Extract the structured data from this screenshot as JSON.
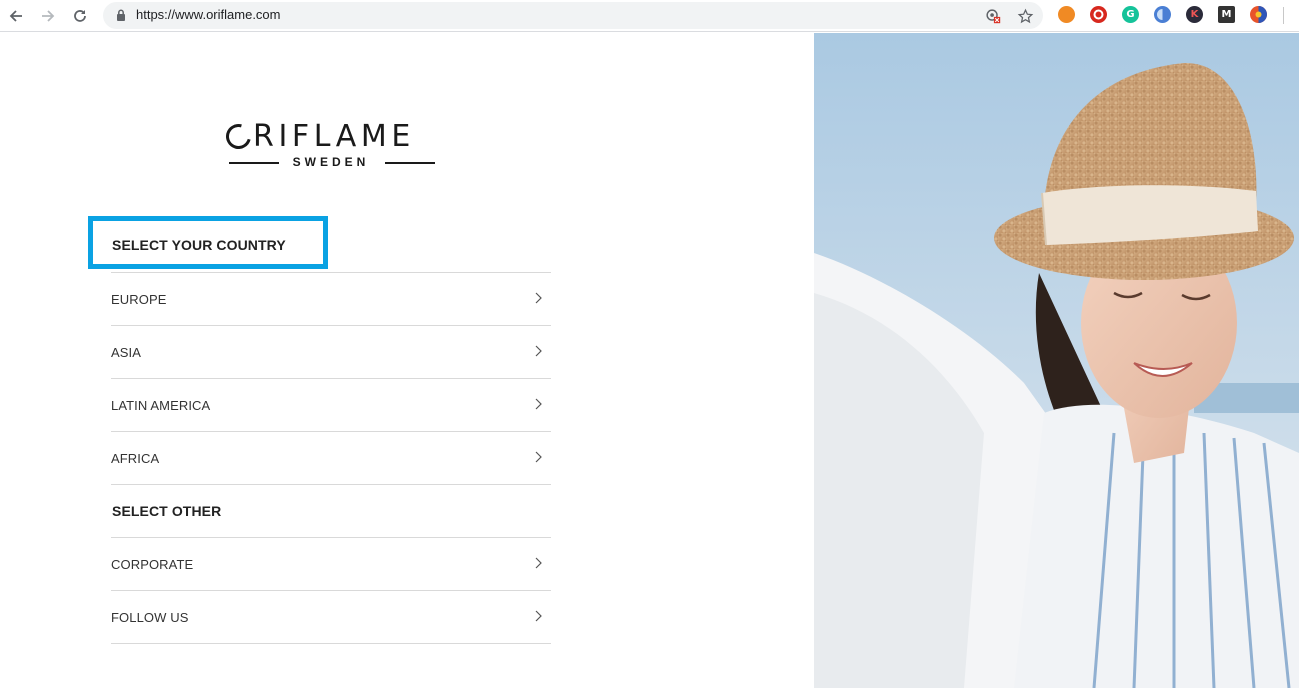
{
  "browser": {
    "url": "https://www.oriflame.com",
    "back_icon": "back-arrow-icon",
    "forward_icon": "forward-arrow-icon",
    "reload_icon": "reload-icon",
    "lock_icon": "lock-icon",
    "star_icon": "star-icon",
    "extensions": [
      {
        "name": "orange-extension-icon",
        "glyph": "",
        "color": "#f08a24"
      },
      {
        "name": "red-extension-icon",
        "glyph": "",
        "color": "#d7281e"
      },
      {
        "name": "grammarly-extension-icon",
        "glyph": "G",
        "color": "#15c39a"
      },
      {
        "name": "blue-extension-icon",
        "glyph": "",
        "color": "#4a7fd4"
      },
      {
        "name": "k-extension-icon",
        "glyph": "K",
        "color": "#2b2b3a"
      },
      {
        "name": "m-extension-icon",
        "glyph": "M",
        "color": "#333333"
      },
      {
        "name": "multicolor-extension-icon",
        "glyph": "",
        "color": "#e8542a"
      }
    ]
  },
  "logo": {
    "word": "RIFLAME",
    "sub": "SWEDEN"
  },
  "country": {
    "heading": "SELECT YOUR COUNTRY",
    "highlight_color": "#0aa2e3",
    "items": [
      {
        "label": "EUROPE"
      },
      {
        "label": "ASIA"
      },
      {
        "label": "LATIN AMERICA"
      },
      {
        "label": "AFRICA"
      }
    ]
  },
  "other": {
    "heading": "SELECT OTHER",
    "items": [
      {
        "label": "CORPORATE"
      },
      {
        "label": "FOLLOW US"
      }
    ]
  }
}
